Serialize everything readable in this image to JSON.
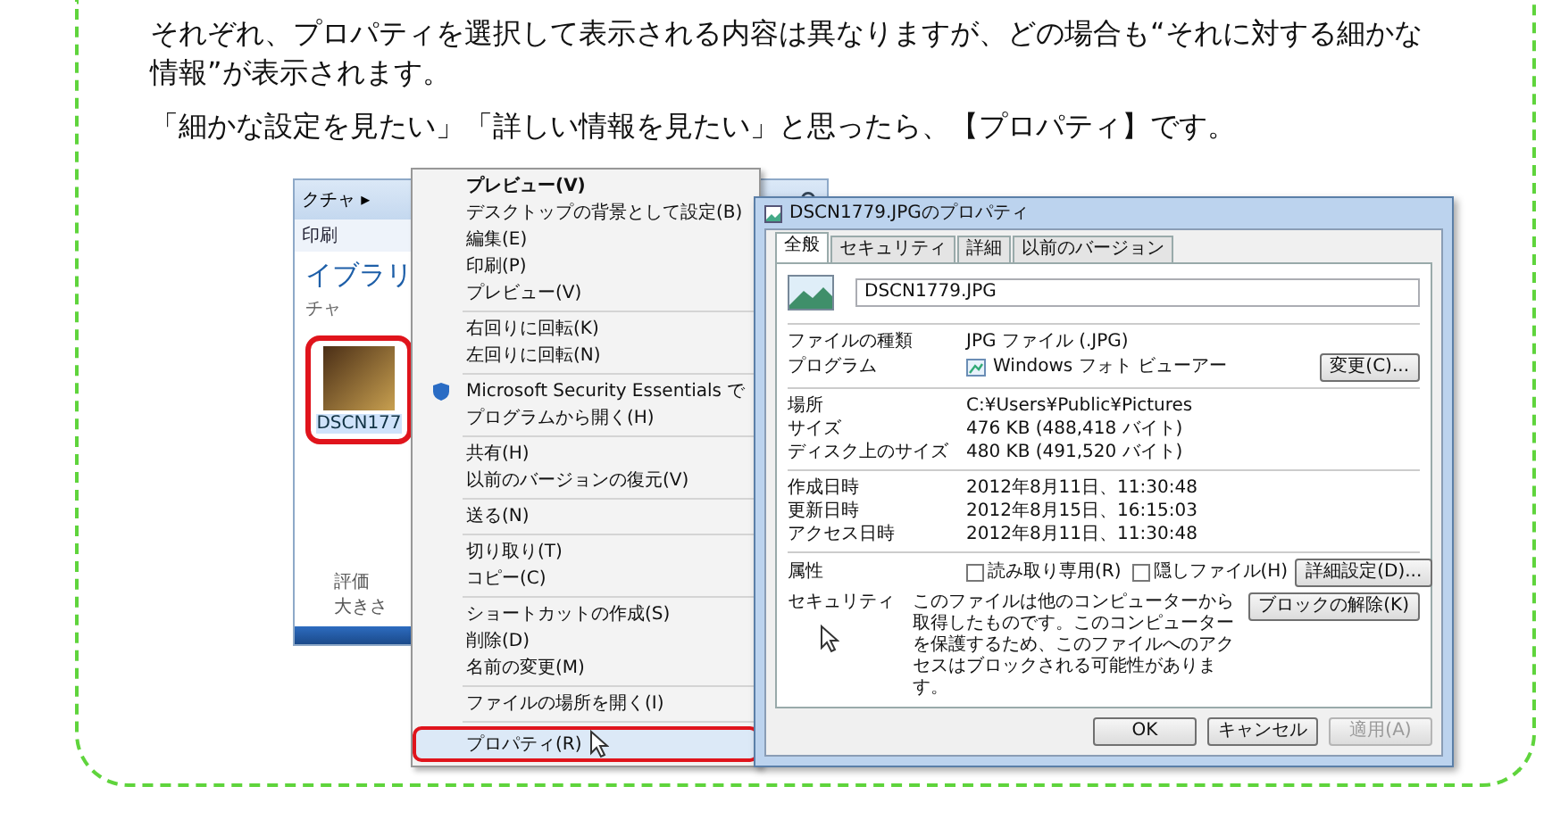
{
  "paragraphs": [
    "それぞれ、プロパティを選択して表示される内容は異なりますが、どの場合も“それに対する細かな情報”が表示されます。",
    "「細かな設定を見たい」「詳しい情報を見たい」と思ったら、【プロパティ】です。"
  ],
  "screenshot": {
    "explorer": {
      "breadcrumb": "クチャ ▸",
      "toolbar_item": "印刷",
      "heading": "イブラリ",
      "subheading": "チャ",
      "thumbnail_label": "DSCN177",
      "thumbnail_highlighted": true,
      "details": [
        "評価",
        "大きさ"
      ]
    },
    "context_menu": {
      "groups": [
        [
          {
            "label": "プレビュー(V)",
            "kind": "default",
            "highlighted": false
          },
          {
            "label": "デスクトップの背景として設定(B)",
            "kind": "plain",
            "highlighted": false
          },
          {
            "label": "編集(E)",
            "kind": "plain",
            "highlighted": false
          },
          {
            "label": "印刷(P)",
            "kind": "plain",
            "highlighted": false
          },
          {
            "label": "プレビュー(V)",
            "kind": "plain",
            "highlighted": false
          }
        ],
        [
          {
            "label": "右回りに回転(K)",
            "kind": "plain",
            "highlighted": false
          },
          {
            "label": "左回りに回転(N)",
            "kind": "plain",
            "highlighted": false
          }
        ],
        [
          {
            "label": "Microsoft Security Essentials で",
            "kind": "icon",
            "highlighted": false
          },
          {
            "label": "プログラムから開く(H)",
            "kind": "plain",
            "highlighted": false
          }
        ],
        [
          {
            "label": "共有(H)",
            "kind": "plain",
            "highlighted": false
          },
          {
            "label": "以前のバージョンの復元(V)",
            "kind": "plain",
            "highlighted": false
          }
        ],
        [
          {
            "label": "送る(N)",
            "kind": "plain",
            "highlighted": false
          }
        ],
        [
          {
            "label": "切り取り(T)",
            "kind": "plain",
            "highlighted": false
          },
          {
            "label": "コピー(C)",
            "kind": "plain",
            "highlighted": false
          }
        ],
        [
          {
            "label": "ショートカットの作成(S)",
            "kind": "plain",
            "highlighted": false
          },
          {
            "label": "削除(D)",
            "kind": "plain",
            "highlighted": false
          },
          {
            "label": "名前の変更(M)",
            "kind": "plain",
            "highlighted": false
          }
        ],
        [
          {
            "label": "ファイルの場所を開く(I)",
            "kind": "plain",
            "highlighted": false
          }
        ],
        [
          {
            "label": "プロパティ(R)",
            "kind": "plain",
            "highlighted": true
          }
        ]
      ]
    },
    "properties_dialog": {
      "title": "DSCN1779.JPGのプロパティ",
      "tabs": [
        {
          "label": "全般",
          "selected": true
        },
        {
          "label": "セキュリティ",
          "selected": false
        },
        {
          "label": "詳細",
          "selected": false
        },
        {
          "label": "以前のバージョン",
          "selected": false
        }
      ],
      "file_name": "DSCN1779.JPG",
      "sections": [
        [
          {
            "label": "ファイルの種類",
            "value": "JPG ファイル (.JPG)",
            "kind": "text"
          },
          {
            "label": "プログラム",
            "value": "Windows フォト ビューアー",
            "button": "変更(C)...",
            "kind": "program"
          }
        ],
        [
          {
            "label": "場所",
            "value": "C:¥Users¥Public¥Pictures",
            "kind": "text"
          },
          {
            "label": "サイズ",
            "value": "476 KB (488,418 バイト)",
            "kind": "text"
          },
          {
            "label": "ディスク上のサイズ",
            "value": "480 KB (491,520 バイト)",
            "kind": "text"
          }
        ],
        [
          {
            "label": "作成日時",
            "value": "2012年8月11日、11:30:48",
            "kind": "text"
          },
          {
            "label": "更新日時",
            "value": "2012年8月15日、16:15:03",
            "kind": "text"
          },
          {
            "label": "アクセス日時",
            "value": "2012年8月11日、11:30:48",
            "kind": "text"
          }
        ]
      ],
      "attributes": {
        "label": "属性",
        "checkboxes": [
          {
            "label": "読み取り専用(R)",
            "checked": false
          },
          {
            "label": "隠しファイル(H)",
            "checked": false
          }
        ],
        "button": "詳細設定(D)..."
      },
      "security": {
        "label": "セキュリティ",
        "text": "このファイルは他のコンピューターから取得したものです。このコンピューターを保護するため、このファイルへのアクセスはブロックされる可能性があります。",
        "button": "ブロックの解除(K)"
      },
      "buttons": [
        {
          "label": "OK",
          "disabled": false
        },
        {
          "label": "キャンセル",
          "disabled": false
        },
        {
          "label": "適用(A)",
          "disabled": true
        }
      ]
    }
  }
}
